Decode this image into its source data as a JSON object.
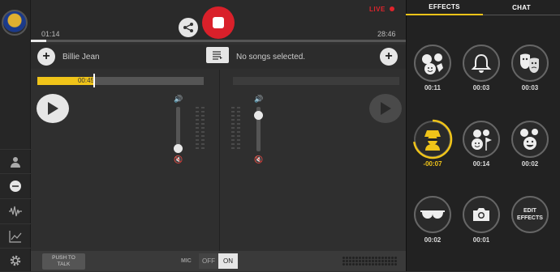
{
  "topbar": {
    "elapsed": "01:14",
    "total": "28:46",
    "elapsed_fraction": 0.042,
    "live_label": "LIVE"
  },
  "deck_a": {
    "song_title": "Billie Jean",
    "position_label": "00:45",
    "position_fraction": 0.34,
    "volume_fraction": 0.1
  },
  "deck_b": {
    "song_title": "No songs selected.",
    "volume_fraction": 0.95
  },
  "bottom": {
    "push_to_talk_line1": "PUSH TO",
    "push_to_talk_line2": "TALK",
    "mic_label": "MIC",
    "mic_off": "OFF",
    "mic_on": "ON"
  },
  "tabs": {
    "effects": "EFFECTS",
    "chat": "CHAT"
  },
  "effects": [
    {
      "icon": "applause-faces-icon",
      "time": "00:11"
    },
    {
      "icon": "bell-icon",
      "time": "00:03"
    },
    {
      "icon": "theater-masks-icon",
      "time": "00:03"
    },
    {
      "icon": "spy-icon",
      "time": "-00:07",
      "active": true
    },
    {
      "icon": "faces-flag-icon",
      "time": "00:14"
    },
    {
      "icon": "laughing-faces-icon",
      "time": "00:02"
    },
    {
      "icon": "sunglasses-icon",
      "time": "00:02"
    },
    {
      "icon": "camera-icon",
      "time": "00:01"
    }
  ],
  "edit_effects": {
    "line1": "EDIT",
    "line2": "EFFECTS"
  },
  "colors": {
    "accent": "#f0c419",
    "record": "#d9202a",
    "live": "#e0242c"
  }
}
